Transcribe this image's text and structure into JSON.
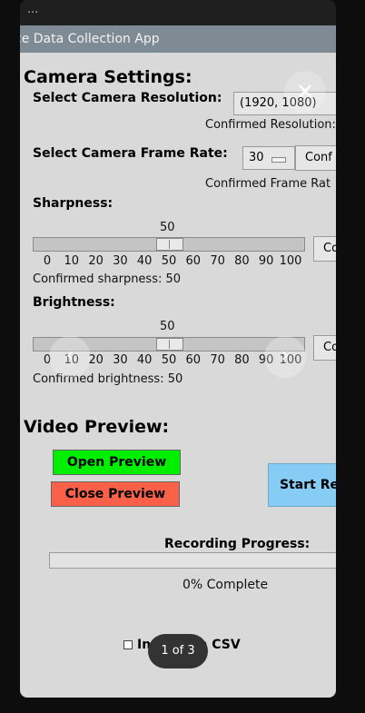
{
  "top_strip_text": "...",
  "app_title": "ce Data Collection App",
  "camera": {
    "heading": "Camera Settings:",
    "resolution_label": "Select Camera Resolution:",
    "resolution_value": "(1920, 1080)",
    "resolution_confirmed": "Confirmed Resolution:",
    "framerate_label": "Select Camera Frame Rate:",
    "framerate_value": "30",
    "framerate_confirm_btn": "Conf",
    "framerate_confirmed": "Confirmed Frame Rat"
  },
  "sharpness": {
    "label": "Sharpness:",
    "value": 50,
    "value_text": "50",
    "confirm_btn": "Co",
    "confirmed": "Confirmed sharpness: 50"
  },
  "brightness": {
    "label": "Brightness:",
    "value": 50,
    "value_text": "50",
    "confirm_btn": "Co",
    "confirmed": "Confirmed brightness: 50"
  },
  "slider_scale": {
    "min": 0,
    "max": 100
  },
  "slider_ticks": [
    "0",
    "10",
    "20",
    "30",
    "40",
    "50",
    "60",
    "70",
    "80",
    "90",
    "100"
  ],
  "video": {
    "heading": "Video Preview:",
    "open_btn": "Open Preview",
    "close_btn": "Close Preview",
    "start_btn": "Start Re"
  },
  "progress": {
    "label": "Recording Progress:",
    "value": 0,
    "text": "0% Complete"
  },
  "csv_label": "Include in CSV",
  "viewer": {
    "counter": "1 of 3",
    "close_glyph": "✕",
    "prev_glyph": "‹",
    "next_glyph": "›"
  },
  "icons": [
    "close-icon",
    "chevron-left-icon",
    "chevron-right-icon",
    "dropdown-arrow-icon"
  ],
  "colors": {
    "open_button": "#00ee00",
    "close_button": "#fa6148",
    "start_button": "#86ccf5",
    "titlebar": "#7f8b94",
    "window_bg": "#d9d9d9"
  }
}
